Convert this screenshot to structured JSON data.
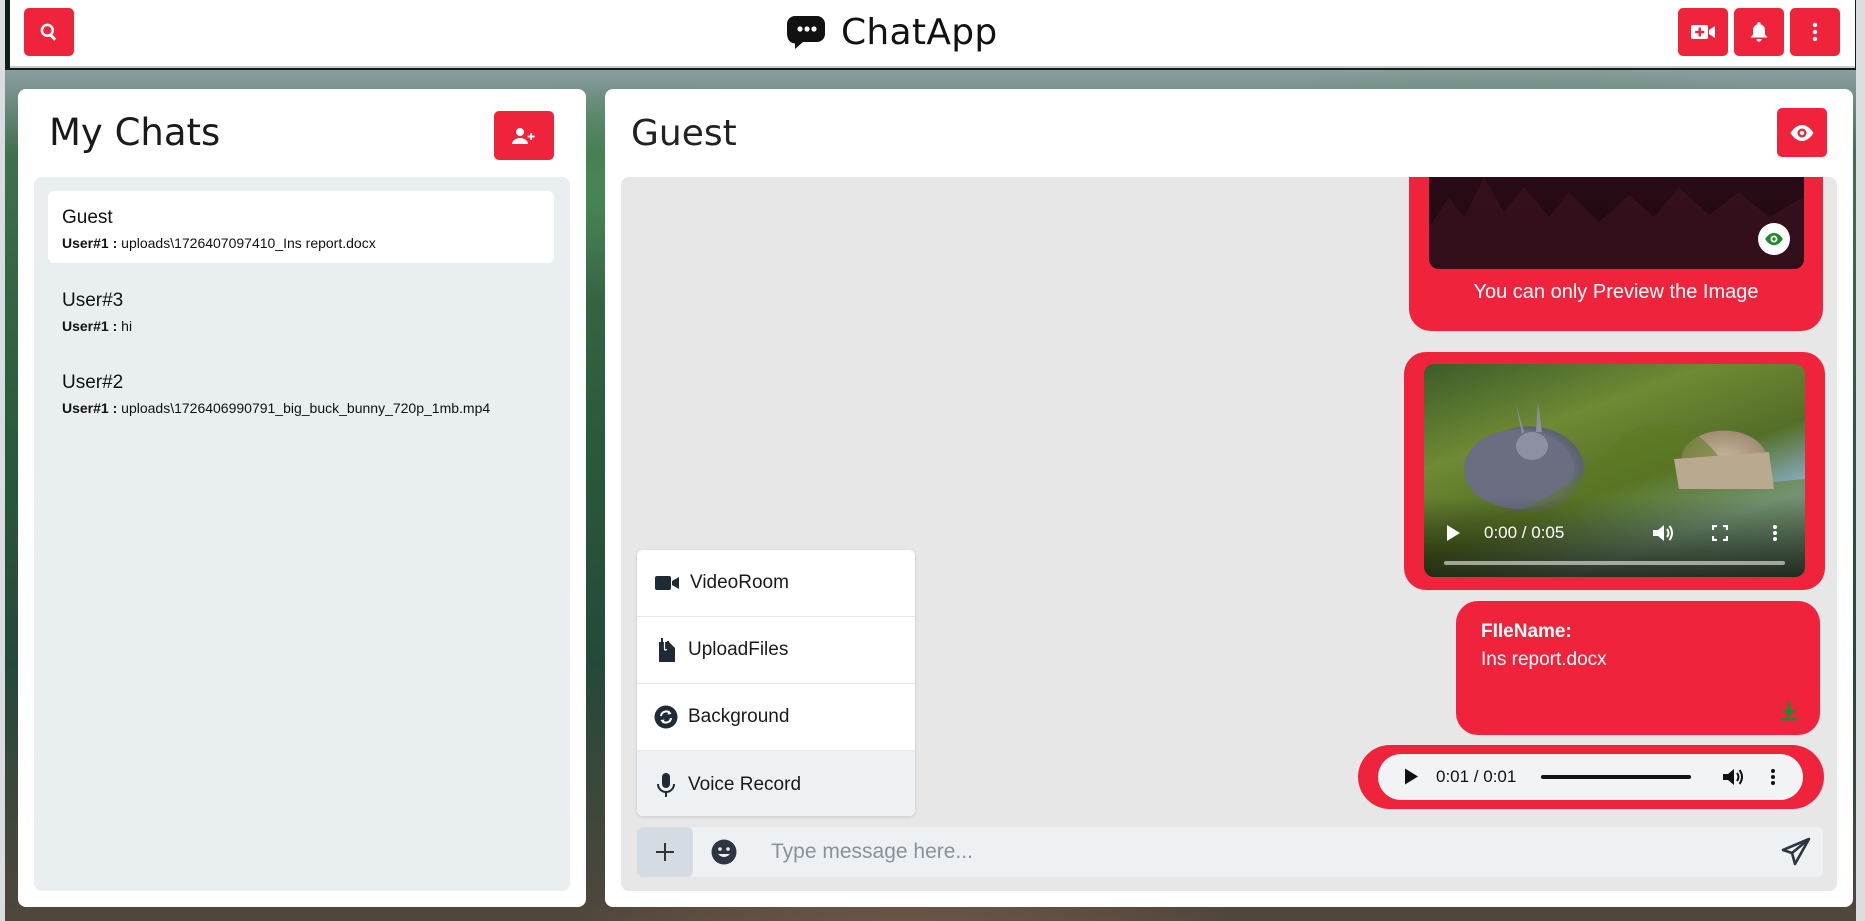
{
  "app": {
    "title": "ChatApp",
    "accent_color": "#ef233c"
  },
  "header": {
    "icons": [
      "search-icon",
      "chat-logo-icon",
      "video-plus-icon",
      "bell-icon",
      "kebab-menu-icon"
    ]
  },
  "sidebar": {
    "title": "My Chats",
    "add_group_icon": "user-plus-icon",
    "chats": [
      {
        "name": "Guest",
        "sender": "User#1 :",
        "preview": "uploads\\1726407097410_Ins report.docx",
        "active": true
      },
      {
        "name": "User#3",
        "sender": "User#1 :",
        "preview": "hi",
        "active": false
      },
      {
        "name": "User#2",
        "sender": "User#1 :",
        "preview": "uploads\\1726406990791_big_buck_bunny_720p_1mb.mp4",
        "active": false
      }
    ]
  },
  "conversation": {
    "title": "Guest",
    "view_profile_icon": "eye-icon",
    "messages": {
      "image_caption": "You can only Preview the Image",
      "video_time": "0:00 / 0:05",
      "file_label": "FIleName:",
      "file_name": "Ins report.docx",
      "audio_time": "0:01 / 0:01"
    }
  },
  "attach_menu": {
    "items": [
      {
        "label": "VideoRoom",
        "icon": "video-camera-icon"
      },
      {
        "label": "UploadFiles",
        "icon": "file-upload-icon"
      },
      {
        "label": "Background",
        "icon": "refresh-circle-icon"
      },
      {
        "label": "Voice Record",
        "icon": "microphone-icon"
      }
    ]
  },
  "composer": {
    "placeholder": "Type message here...",
    "value": ""
  }
}
